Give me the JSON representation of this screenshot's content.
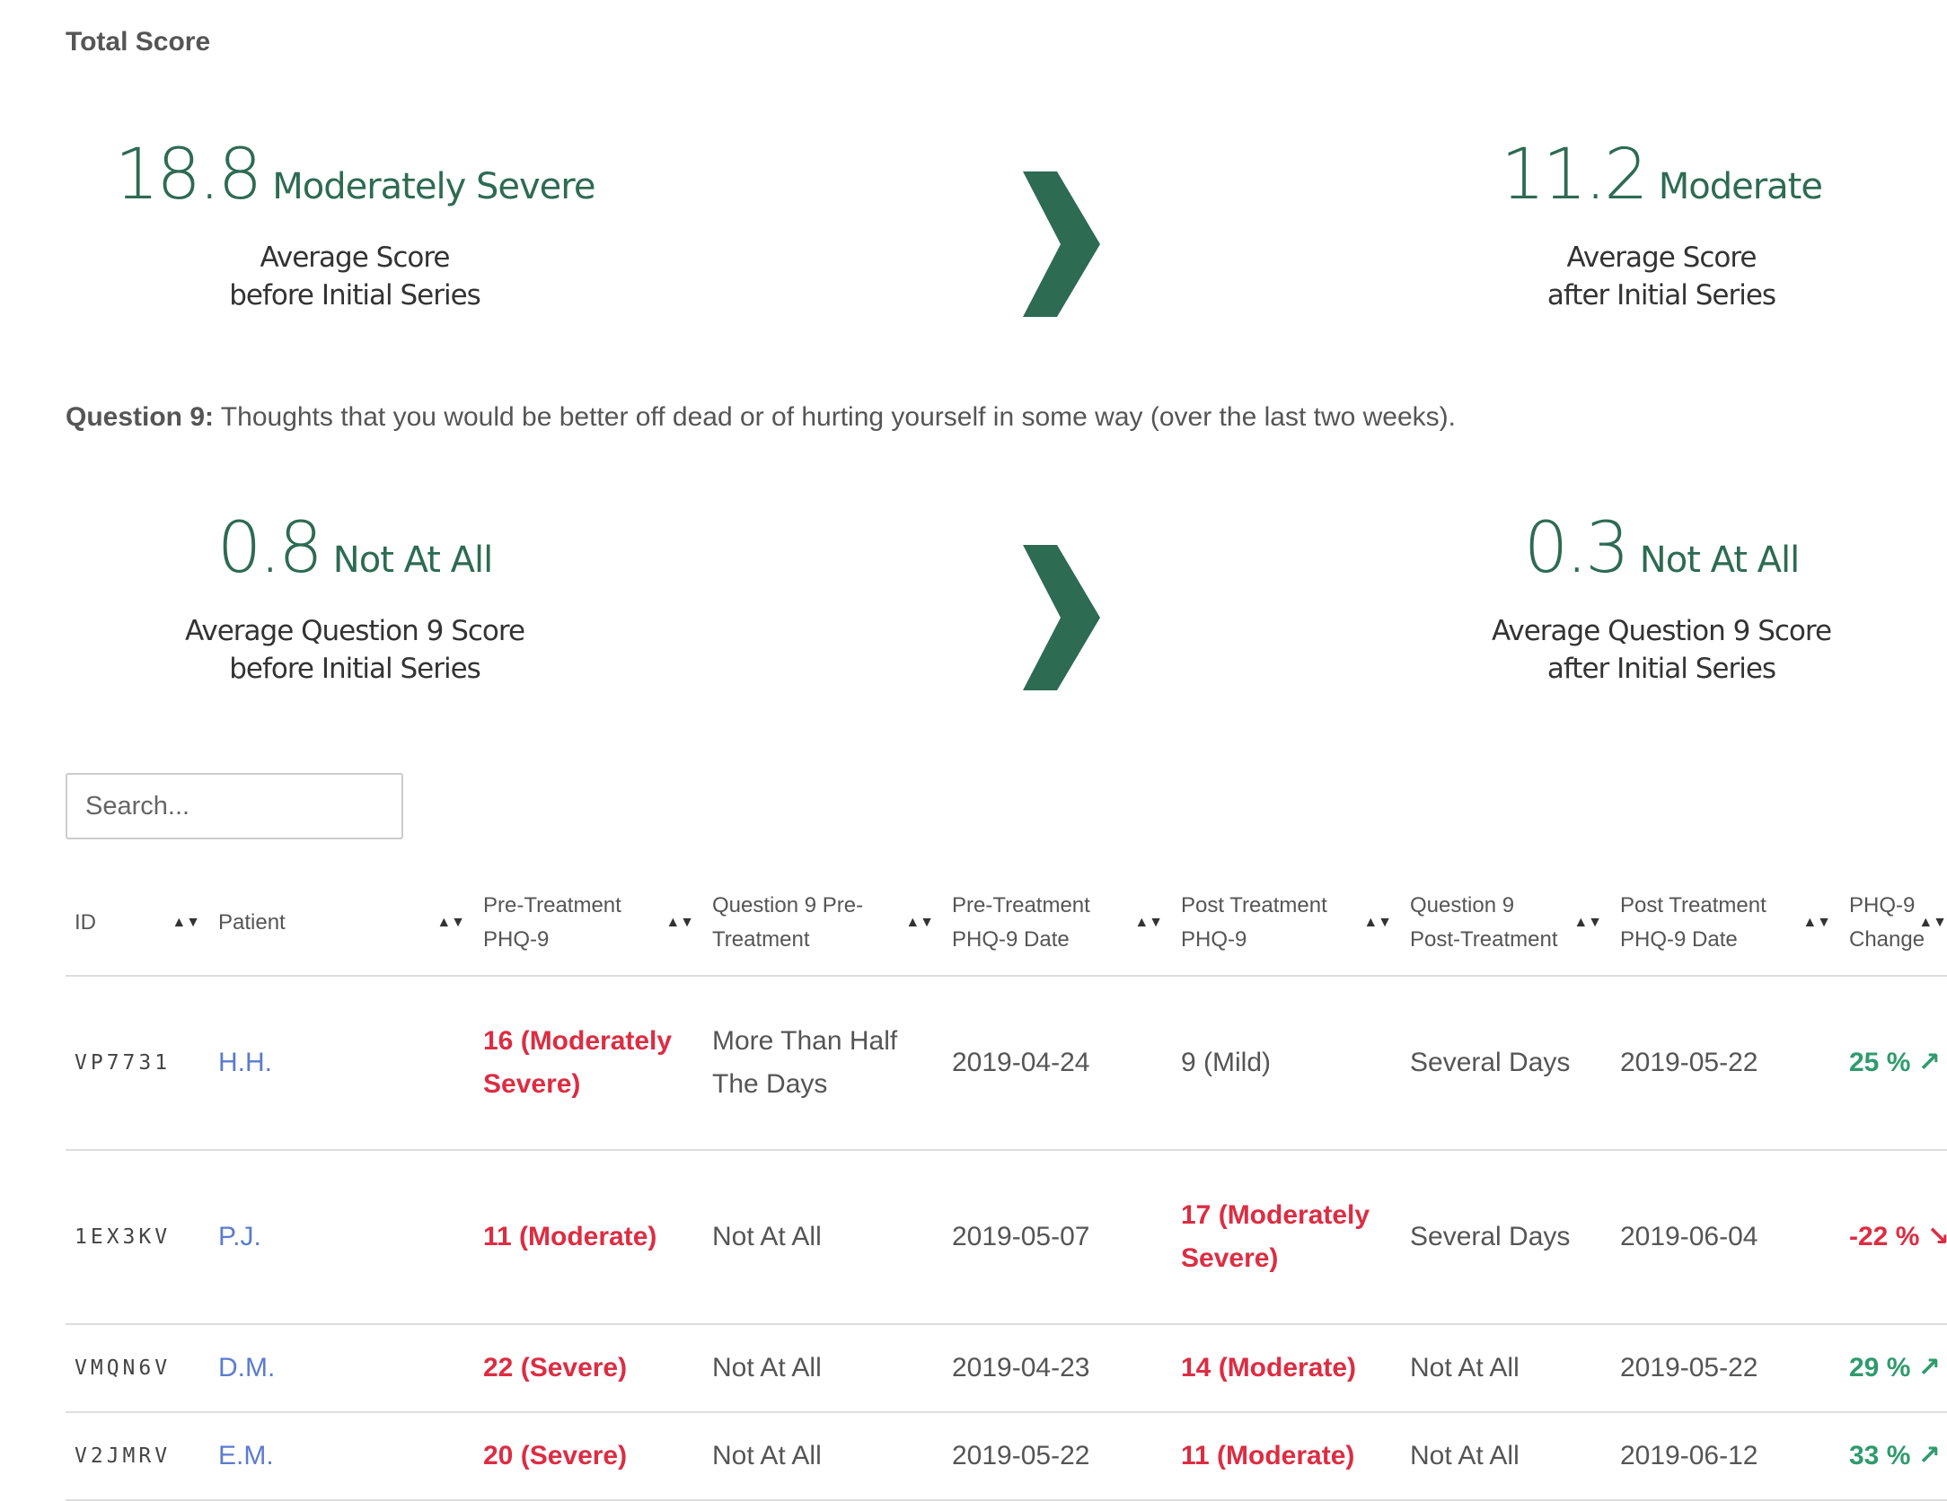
{
  "total_score": {
    "heading": "Total Score",
    "before": {
      "value": "18.8",
      "category": "Moderately Severe",
      "caption_line1": "Average Score",
      "caption_line2": "before Initial Series"
    },
    "after": {
      "value": "11.2",
      "category": "Moderate",
      "caption_line1": "Average Score",
      "caption_line2": "after Initial Series"
    }
  },
  "question9": {
    "label": "Question 9:",
    "text": " Thoughts that you would be better off dead or of hurting yourself in some way (over the last two weeks).",
    "before": {
      "value": "0.8",
      "category": "Not At All",
      "caption_line1": "Average Question 9 Score",
      "caption_line2": "before Initial Series"
    },
    "after": {
      "value": "0.3",
      "category": "Not At All",
      "caption_line1": "Average Question 9 Score",
      "caption_line2": "after Initial Series"
    }
  },
  "colors": {
    "accent_green": "#2d6b52",
    "severe_red": "#dc2d43",
    "improve_green": "#2f9b6d",
    "link_blue": "#5b7bd0"
  },
  "icons": {
    "arrow": "chevron-right-icon",
    "sort": "sort-icon",
    "trend_up": "arrow-up-right-icon",
    "trend_down": "arrow-down-right-icon"
  },
  "search": {
    "placeholder": "Search..."
  },
  "table": {
    "headers": {
      "id": "ID",
      "patient": "Patient",
      "pre_phq": "Pre-Treatment PHQ-9",
      "q9_pre": "Question 9 Pre-Treatment",
      "pre_date": "Pre-Treatment PHQ-9 Date",
      "post_phq": "Post Treatment PHQ-9",
      "q9_post": "Question 9 Post-Treatment",
      "post_date": "Post Treatment PHQ-9 Date",
      "change": "PHQ-9 Change"
    },
    "rows": [
      {
        "id": "VP7731",
        "patient": "H.H.",
        "pre_phq": "16 (Moderately Severe)",
        "q9_pre": "More Than Half The Days",
        "pre_date": "2019-04-24",
        "post_phq": "9 (Mild)",
        "q9_post": "Several Days",
        "post_date": "2019-05-22",
        "change": "25 % ↗"
      },
      {
        "id": "1EX3KV",
        "patient": "P.J.",
        "pre_phq": "11 (Moderate)",
        "q9_pre": "Not At All",
        "pre_date": "2019-05-07",
        "post_phq": "17 (Moderately Severe)",
        "q9_post": "Several Days",
        "post_date": "2019-06-04",
        "change": "-22 % ↘"
      },
      {
        "id": "VMQN6V",
        "patient": "D.M.",
        "pre_phq": "22 (Severe)",
        "q9_pre": "Not At All",
        "pre_date": "2019-04-23",
        "post_phq": "14 (Moderate)",
        "q9_post": "Not At All",
        "post_date": "2019-05-22",
        "change": "29 % ↗"
      },
      {
        "id": "V2JMRV",
        "patient": "E.M.",
        "pre_phq": "20 (Severe)",
        "q9_pre": "Not At All",
        "pre_date": "2019-05-22",
        "post_phq": "11 (Moderate)",
        "q9_post": "Not At All",
        "post_date": "2019-06-12",
        "change": "33 % ↗"
      }
    ]
  }
}
